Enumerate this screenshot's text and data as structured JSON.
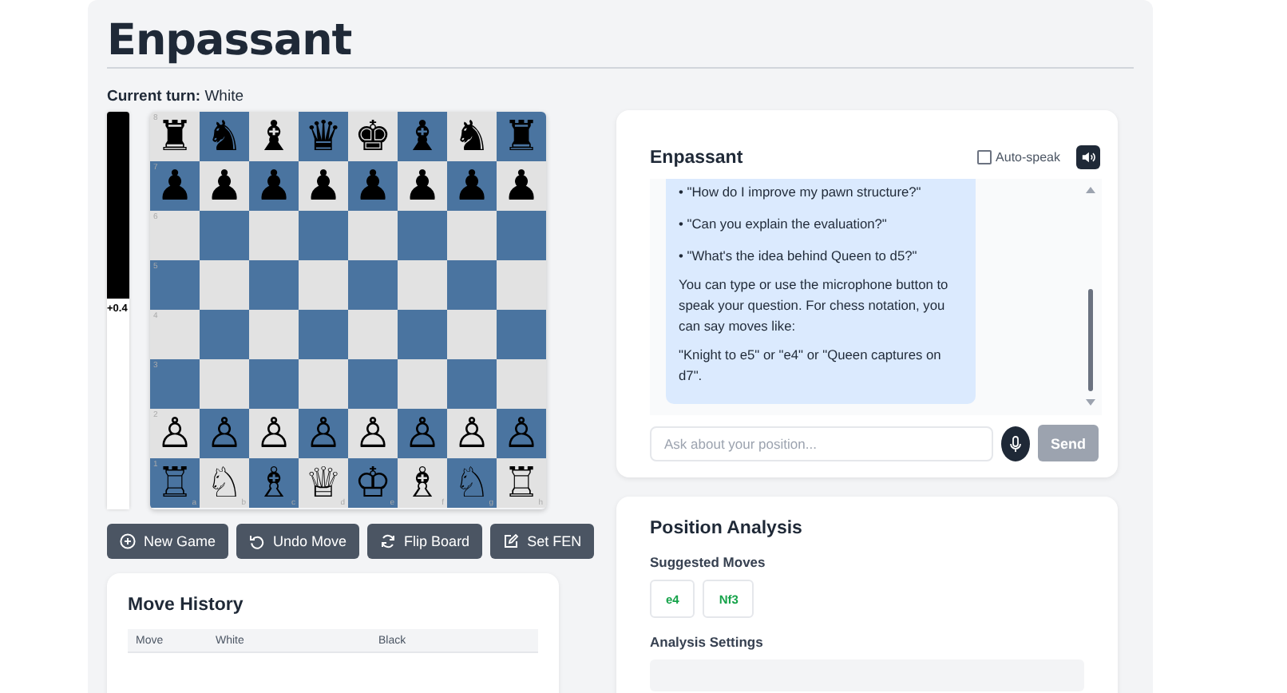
{
  "title": "Enpassant",
  "turn": {
    "label": "Current turn:",
    "value": "White"
  },
  "eval_bar": {
    "level": 0.53,
    "reading": "+0.4"
  },
  "board": {
    "files": [
      "a",
      "b",
      "c",
      "d",
      "e",
      "f",
      "g",
      "h"
    ],
    "ranks": [
      {
        "label": "8",
        "pieces": [
          "♜",
          "♞",
          "♝",
          "♛",
          "♚",
          "♝",
          "♞",
          "♜"
        ]
      },
      {
        "label": "7",
        "pieces": [
          "♟",
          "♟",
          "♟",
          "♟",
          "♟",
          "♟",
          "♟",
          "♟"
        ]
      },
      {
        "label": "6"
      },
      {
        "label": "5"
      },
      {
        "label": "4"
      },
      {
        "label": "3"
      },
      {
        "label": "2",
        "pieces": [
          "♙",
          "♙",
          "♙",
          "♙",
          "♙",
          "♙",
          "♙",
          "♙"
        ]
      },
      {
        "label": "1",
        "pieces": [
          "♖",
          "♘",
          "♗",
          "♕",
          "♔",
          "♗",
          "♘",
          "♖"
        ]
      }
    ]
  },
  "controls": [
    {
      "kind": "new",
      "label": "New Game"
    },
    {
      "kind": "undo",
      "label": "Undo Move"
    },
    {
      "kind": "flip",
      "label": "Flip Board"
    },
    {
      "kind": "edit",
      "label": "Set FEN"
    }
  ],
  "move_history": {
    "title": "Move History",
    "columns": [
      "Move",
      "White",
      "Black"
    ]
  },
  "chat": {
    "title": "Enpassant",
    "auto_speak": {
      "label": "Auto-speak",
      "checked": false
    },
    "message": {
      "lines": [
        {
          "kind": "bullet",
          "text": "• \"How do I improve my pawn structure?\""
        },
        {
          "kind": "bullet",
          "text": "• \"Can you explain the evaluation?\""
        },
        {
          "kind": "bullet",
          "text": "• \"What's the idea behind Queen to d5?\""
        },
        {
          "kind": "para",
          "text": "You can type or use the microphone button to speak your question. For chess notation, you can say moves like:"
        },
        {
          "kind": "para",
          "text": "\"Knight to e5\" or \"e4\" or \"Queen captures on d7\"."
        }
      ]
    },
    "input": {
      "placeholder": "Ask about your position..."
    },
    "send": {
      "label": "Send",
      "disabled": true
    }
  },
  "analysis": {
    "title": "Position Analysis",
    "suggested_title": "Suggested Moves",
    "moves": [
      "e4",
      "Nf3"
    ],
    "settings_title": "Analysis Settings"
  }
}
